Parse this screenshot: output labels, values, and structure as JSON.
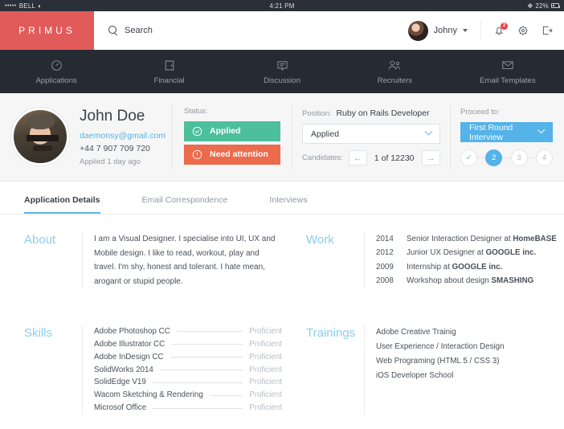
{
  "statusbar": {
    "carrier": "BELL",
    "dots": "•••••",
    "wifi_icon": "wifi-icon",
    "time": "4:21 PM",
    "bluetooth_icon": "bluetooth-icon",
    "battery": "22%"
  },
  "header": {
    "logo": "PRIMUS",
    "logo_color": "#e15b5b",
    "search_placeholder": "Search",
    "search_value": "",
    "user_name": "Johny",
    "notifications_count": "2",
    "icons": [
      "bell-icon",
      "gear-icon",
      "logout-icon"
    ]
  },
  "nav": {
    "items": [
      {
        "label": "Applications",
        "icon": "gauge-icon"
      },
      {
        "label": "Financial",
        "icon": "wallet-icon"
      },
      {
        "label": "Discussion",
        "icon": "chat-icon"
      },
      {
        "label": "Recruiters",
        "icon": "people-icon"
      },
      {
        "label": "Email Templates",
        "icon": "envelope-icon"
      }
    ]
  },
  "profile": {
    "name": "John Doe",
    "email": "daemonsy@gmail.com",
    "phone": "+44 7 907 709 720",
    "applied_ago": "Applied 1 day ago",
    "status_label": "Status:",
    "status_applied": "Applied",
    "status_attention": "Need attention",
    "status_applied_color": "#4dbf9c",
    "status_attention_color": "#ec6b4c",
    "position_label": "Position:",
    "position_value": "Ruby on Rails Developer",
    "stage_select": "Applied",
    "candidates_label": "Candidates:",
    "candidates_count": "1 of 12230",
    "prev_arrow": "←",
    "next_arrow": "→",
    "proceed_label": "Proceed to:",
    "proceed_value": "First Round Interview",
    "proceed_color": "#54b3e8",
    "steps": [
      {
        "label": "✓",
        "state": "done"
      },
      {
        "label": "2",
        "state": "active"
      },
      {
        "label": "3",
        "state": "idle"
      },
      {
        "label": "4",
        "state": "idle"
      }
    ]
  },
  "tabs": [
    {
      "label": "Application Details",
      "active": true
    },
    {
      "label": "Email Correspondence",
      "active": false
    },
    {
      "label": "Interviews",
      "active": false
    }
  ],
  "about": {
    "title": "About",
    "text": "I am a Visual Designer. I specialise into UI, UX and Mobile design. I like to read, workout, play and travel. I'm shy, honest and tolerant. I hate mean, arogant or stupid people."
  },
  "work": {
    "title": "Work",
    "items": [
      {
        "year": "2014",
        "pre": "Senior Interaction Designer at ",
        "org": "HomeBASE",
        "post": ""
      },
      {
        "year": "2012",
        "pre": "Junior UX Designer at ",
        "org": "GOOGLE inc.",
        "post": ""
      },
      {
        "year": "2009",
        "pre": "Internship at ",
        "org": "GOOGLE inc.",
        "post": ""
      },
      {
        "year": "2008",
        "pre": "Workshop about design ",
        "org": "SMASHING",
        "post": ""
      }
    ]
  },
  "skills": {
    "title": "Skills",
    "items": [
      {
        "name": "Adobe Photoshop CC",
        "level": "Proficient"
      },
      {
        "name": "Adobe Illustrator CC",
        "level": "Proficient"
      },
      {
        "name": "Adobe InDesign CC",
        "level": "Proficient"
      },
      {
        "name": "SolidWorks 2014",
        "level": "Proficient"
      },
      {
        "name": "SolidEdge V19",
        "level": "Proficient"
      },
      {
        "name": "Wacom Sketching & Rendering",
        "level": "Proficient"
      },
      {
        "name": "Microsof Office",
        "level": "Proficient"
      }
    ]
  },
  "trainings": {
    "title": "Trainings",
    "items": [
      "Adobe Creative Trainig",
      "User Experience / Interaction Design",
      "Web Programing (HTML 5 / CSS 3)",
      "iOS Developer School"
    ]
  }
}
